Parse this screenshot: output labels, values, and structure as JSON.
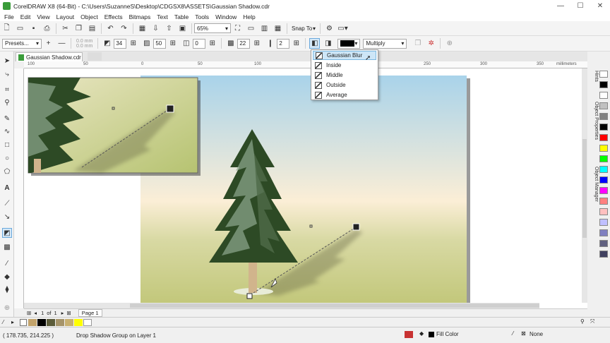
{
  "window": {
    "title": "CorelDRAW X8 (64-Bit) - C:\\Users\\SuzanneS\\Desktop\\CDGSX8\\ASSETS\\Gaussian Shadow.cdr",
    "watermark": "优酷"
  },
  "menu": [
    "File",
    "Edit",
    "View",
    "Layout",
    "Object",
    "Effects",
    "Bitmaps",
    "Text",
    "Table",
    "Tools",
    "Window",
    "Help"
  ],
  "toolbar1": {
    "zoom": "65%",
    "snap_to": "Snap To"
  },
  "toolbar2": {
    "presets": "Presets...",
    "x_offset": "0.0 mm",
    "y_offset": "0.0 mm",
    "shadow_angle": "34",
    "opacity": "50",
    "feather": "0",
    "shadow_fade": "22",
    "stretch": "2",
    "blend_mode": "Multiply"
  },
  "document_tab": "Gaussian Shadow.cdr",
  "ruler": {
    "h_labels": [
      "100",
      "50",
      "0",
      "50",
      "100",
      "150",
      "200",
      "250",
      "300",
      "350"
    ],
    "units": "millimeters"
  },
  "feather_menu": {
    "items": [
      "Gaussian Blur",
      "Inside",
      "Middle",
      "Outside",
      "Average"
    ],
    "selected": "Gaussian Blur"
  },
  "docker_tabs": [
    "Hints",
    "Object Properties",
    "Object Manager"
  ],
  "page_nav": {
    "current": "1",
    "of": "of",
    "total": "1",
    "page_label": "Page 1"
  },
  "status": {
    "coords": "( 178.735, 214.225 )",
    "message": "Drop Shadow Group on Layer 1",
    "fill": "Fill Color",
    "outline": "None"
  },
  "colors": {
    "sky_top": "#a9d3ea",
    "sky_mid": "#fbeed6",
    "ground": "#c7cb7e",
    "tree_dark": "#2d4a25",
    "tree_light": "#8fa88f",
    "trunk": "#d1b48c",
    "selection": "#cde6f7"
  },
  "palette": [
    "#ffffff",
    "#000000",
    "#ffffff",
    "#c0c0c0",
    "#808080",
    "#000000",
    "#ff0000",
    "#ffff00",
    "#00ff00",
    "#00ffff",
    "#0000ff",
    "#ff00ff",
    "#ff8080",
    "#ffc0c0",
    "#c0c0ff",
    "#8080c0",
    "#606080",
    "#404060"
  ]
}
